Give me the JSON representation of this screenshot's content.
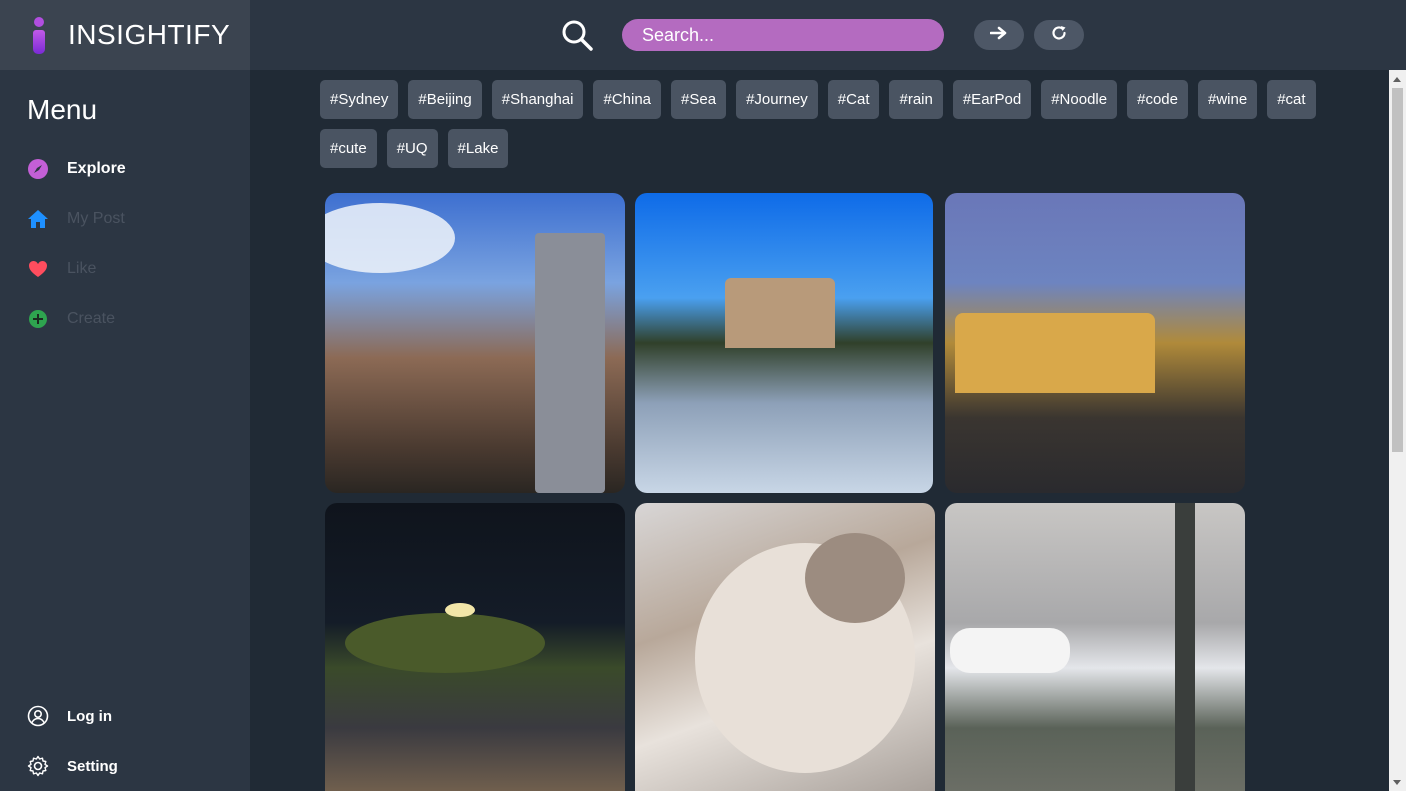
{
  "brand": {
    "name": "INSIGHTIFY",
    "logo_icon": "i-logo-icon"
  },
  "sidebar": {
    "menu_title": "Menu",
    "items": [
      {
        "label": "Explore",
        "icon": "compass-icon",
        "color": "#c35fd6",
        "state": "active"
      },
      {
        "label": "My Post",
        "icon": "home-icon",
        "color": "#1e90ff",
        "state": "dim"
      },
      {
        "label": "Like",
        "icon": "heart-icon",
        "color": "#ff4d5e",
        "state": "dim"
      },
      {
        "label": "Create",
        "icon": "plus-circle-icon",
        "color": "#2ea44f",
        "state": "dim"
      }
    ],
    "bottom_items": [
      {
        "label": "Log in",
        "icon": "user-circle-icon"
      },
      {
        "label": "Setting",
        "icon": "gear-icon"
      }
    ]
  },
  "header": {
    "search_placeholder": "Search...",
    "search_icon": "search-icon",
    "go_icon": "arrow-right-icon",
    "refresh_icon": "refresh-icon",
    "accent_color": "#b46bc0"
  },
  "tags": [
    "#Sydney",
    "#Beijing",
    "#Shanghai",
    "#China",
    "#Sea",
    "#Journey",
    "#Cat",
    "#rain",
    "#EarPod",
    "#Noodle",
    "#code",
    "#wine",
    "#cat",
    "#cute",
    "#UQ",
    "#Lake"
  ]
}
